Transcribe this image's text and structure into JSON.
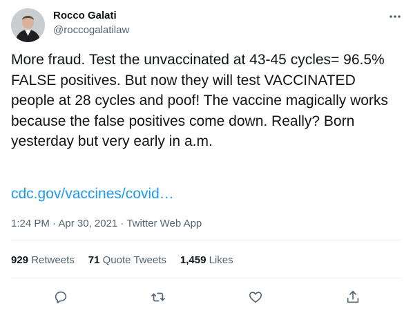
{
  "user": {
    "name": "Rocco Galati",
    "handle": "@roccogalatilaw"
  },
  "tweet": {
    "text": "More fraud. Test the unvaccinated at 43-45 cycles= 96.5% FALSE positives. But now they will test VACCINATED people at 28 cycles and poof! The vaccine magically works because the false positives come down. Really? Born yesterday but very early in a.m.",
    "link": "cdc.gov/vaccines/covid…",
    "time": "1:24 PM · Apr 30, 2021 · Twitter Web App"
  },
  "stats": [
    {
      "count": "929",
      "label": "Retweets"
    },
    {
      "count": "71",
      "label": "Quote Tweets"
    },
    {
      "count": "1,459",
      "label": "Likes"
    }
  ],
  "icons": {
    "more": "more-dots-icon",
    "reply": "reply-icon",
    "retweet": "retweet-icon",
    "like": "like-icon",
    "share": "share-icon"
  },
  "colors": {
    "link": "#1d9bf0",
    "secondary_text": "#536471",
    "icon": "#536471",
    "divider": "#eff3f4"
  }
}
